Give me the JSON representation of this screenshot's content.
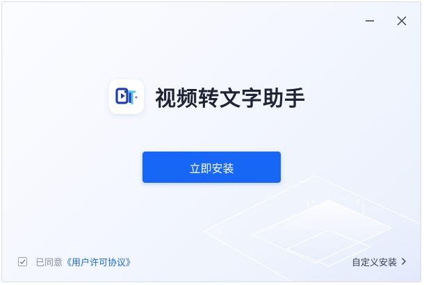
{
  "app": {
    "title": "视频转文字助手",
    "logo_icon": "video-to-text-logo-icon"
  },
  "window_controls": {
    "minimize_icon": "minimize-icon",
    "close_icon": "close-icon"
  },
  "install": {
    "button_label": "立即安装"
  },
  "agreement": {
    "checked": true,
    "prefix": "已同意",
    "link_label": "《用户许可协议》"
  },
  "custom_install": {
    "label": "自定义安装",
    "icon": "chevron-right-icon"
  },
  "colors": {
    "accent": "#1866f5",
    "title_text": "#1f2333",
    "muted_text": "#8a90a0"
  }
}
